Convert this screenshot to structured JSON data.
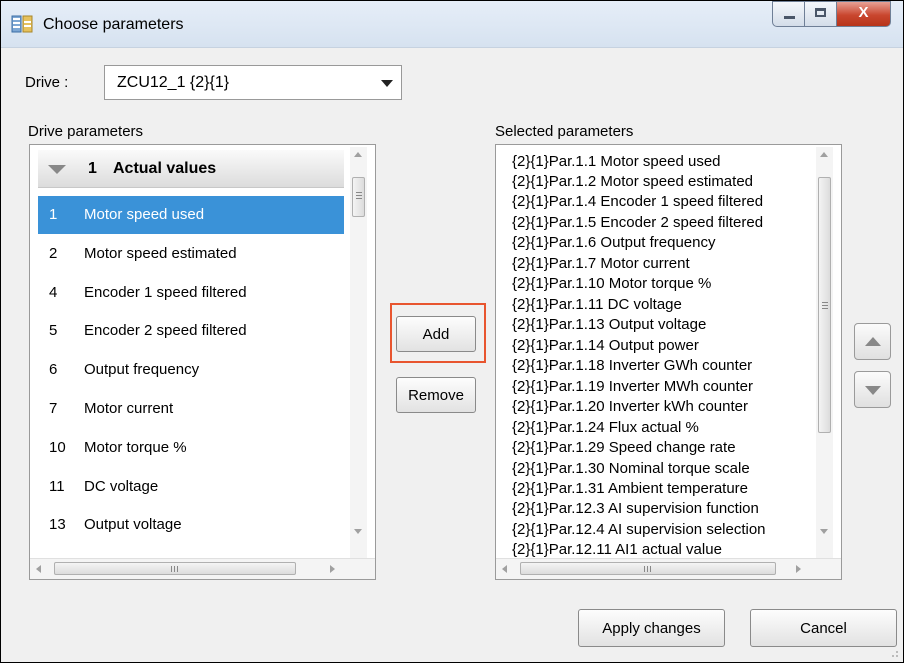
{
  "window": {
    "title": "Choose parameters",
    "close_label": "X"
  },
  "drive": {
    "label": "Drive :",
    "selected": "ZCU12_1 {2}{1}"
  },
  "drive_parameters": {
    "label": "Drive parameters",
    "group": {
      "number": "1",
      "label": "Actual values"
    },
    "items": [
      {
        "num": "1",
        "label": "Motor speed used",
        "selected": true
      },
      {
        "num": "2",
        "label": "Motor speed estimated"
      },
      {
        "num": "4",
        "label": "Encoder 1 speed filtered"
      },
      {
        "num": "5",
        "label": "Encoder 2 speed filtered"
      },
      {
        "num": "6",
        "label": "Output frequency"
      },
      {
        "num": "7",
        "label": "Motor current"
      },
      {
        "num": "10",
        "label": "Motor torque %"
      },
      {
        "num": "11",
        "label": "DC voltage"
      },
      {
        "num": "13",
        "label": "Output voltage"
      }
    ]
  },
  "actions": {
    "add_label": "Add",
    "remove_label": "Remove"
  },
  "selected_parameters": {
    "label": "Selected parameters",
    "items": [
      "{2}{1}Par.1.1  Motor speed used",
      "{2}{1}Par.1.2  Motor speed estimated",
      "{2}{1}Par.1.4  Encoder 1 speed filtered",
      "{2}{1}Par.1.5  Encoder 2 speed filtered",
      "{2}{1}Par.1.6  Output frequency",
      "{2}{1}Par.1.7  Motor current",
      "{2}{1}Par.1.10  Motor torque %",
      "{2}{1}Par.1.11  DC voltage",
      "{2}{1}Par.1.13  Output voltage",
      "{2}{1}Par.1.14  Output power",
      "{2}{1}Par.1.18  Inverter GWh counter",
      "{2}{1}Par.1.19  Inverter MWh counter",
      "{2}{1}Par.1.20  Inverter kWh counter",
      "{2}{1}Par.1.24  Flux actual %",
      "{2}{1}Par.1.29  Speed change rate",
      "{2}{1}Par.1.30  Nominal torque scale",
      "{2}{1}Par.1.31  Ambient temperature",
      "{2}{1}Par.12.3  AI supervision function",
      "{2}{1}Par.12.4  AI supervision selection",
      "{2}{1}Par.12.11  AI1 actual value"
    ]
  },
  "footer": {
    "apply_label": "Apply changes",
    "cancel_label": "Cancel"
  },
  "colors": {
    "selection": "#3a92d8",
    "highlight_border": "#e8552f",
    "close_button": "#c9462f"
  }
}
